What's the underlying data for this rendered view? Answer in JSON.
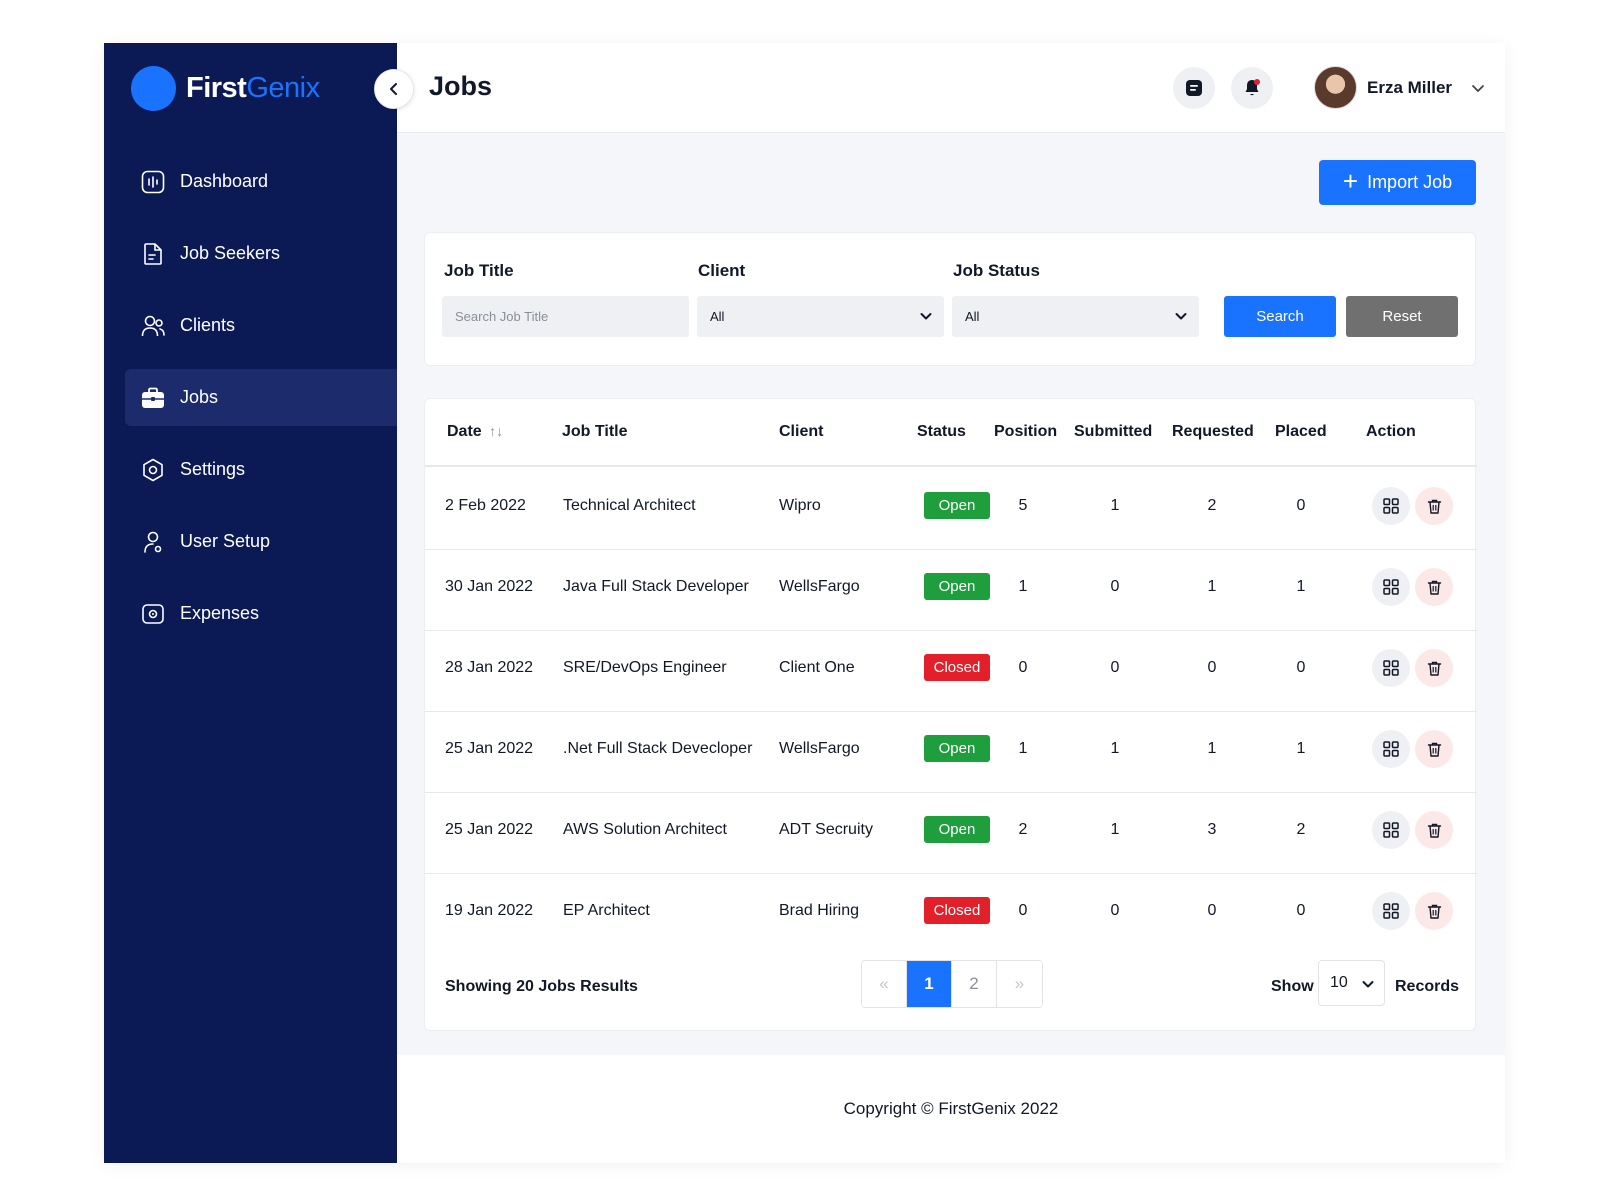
{
  "brand": {
    "first": "First",
    "second": "Genix"
  },
  "sidebar": {
    "items": [
      {
        "label": "Dashboard",
        "icon": "dashboard-icon",
        "active": false
      },
      {
        "label": "Job Seekers",
        "icon": "document-icon",
        "active": false
      },
      {
        "label": "Clients",
        "icon": "users-icon",
        "active": false
      },
      {
        "label": "Jobs",
        "icon": "briefcase-icon",
        "active": true
      },
      {
        "label": "Settings",
        "icon": "settings-icon",
        "active": false
      },
      {
        "label": "User Setup",
        "icon": "user-setup-icon",
        "active": false
      },
      {
        "label": "Expenses",
        "icon": "wallet-icon",
        "active": false
      }
    ]
  },
  "header": {
    "title": "Jobs",
    "user_name": "Erza Miller"
  },
  "import_label": "Import Job",
  "filters": {
    "job_title_label": "Job Title",
    "job_title_placeholder": "Search Job Title",
    "client_label": "Client",
    "client_value": "All",
    "status_label": "Job Status",
    "status_value": "All",
    "search_label": "Search",
    "reset_label": "Reset"
  },
  "table": {
    "columns": [
      "Date",
      "Job Title",
      "Client",
      "Status",
      "Position",
      "Submitted",
      "Requested",
      "Placed",
      "Action"
    ],
    "sort_glyph": "↑↓",
    "rows": [
      {
        "date": "2 Feb 2022",
        "title": "Technical Architect",
        "client": "Wipro",
        "status": "Open",
        "position": "5",
        "submitted": "1",
        "requested": "2",
        "placed": "0"
      },
      {
        "date": "30 Jan 2022",
        "title": "Java Full Stack Developer",
        "client": "WellsFargo",
        "status": "Open",
        "position": "1",
        "submitted": "0",
        "requested": "1",
        "placed": "1"
      },
      {
        "date": "28 Jan 2022",
        "title": "SRE/DevOps Engineer",
        "client": "Client One",
        "status": "Closed",
        "position": "0",
        "submitted": "0",
        "requested": "0",
        "placed": "0"
      },
      {
        "date": "25 Jan 2022",
        "title": ".Net Full Stack Devecloper",
        "client": "WellsFargo",
        "status": "Open",
        "position": "1",
        "submitted": "1",
        "requested": "1",
        "placed": "1"
      },
      {
        "date": "25 Jan 2022",
        "title": "AWS Solution Architect",
        "client": "ADT Secruity",
        "status": "Open",
        "position": "2",
        "submitted": "1",
        "requested": "3",
        "placed": "2"
      },
      {
        "date": "19 Jan 2022",
        "title": "EP Architect",
        "client": "Brad Hiring",
        "status": "Closed",
        "position": "0",
        "submitted": "0",
        "requested": "0",
        "placed": "0"
      }
    ]
  },
  "pagination": {
    "showing": "Showing 20 Jobs Results",
    "prev": "«",
    "pages": [
      "1",
      "2"
    ],
    "current": "1",
    "next": "»",
    "show_label": "Show",
    "records_value": "10",
    "records_label": "Records"
  },
  "footer": {
    "copyright": "Copyright © FirstGenix 2022"
  },
  "colors": {
    "sidebar_bg": "#0b1a55",
    "accent": "#1a73ff",
    "open": "#1e9e3c",
    "closed": "#e3202a",
    "reset": "#707070"
  }
}
